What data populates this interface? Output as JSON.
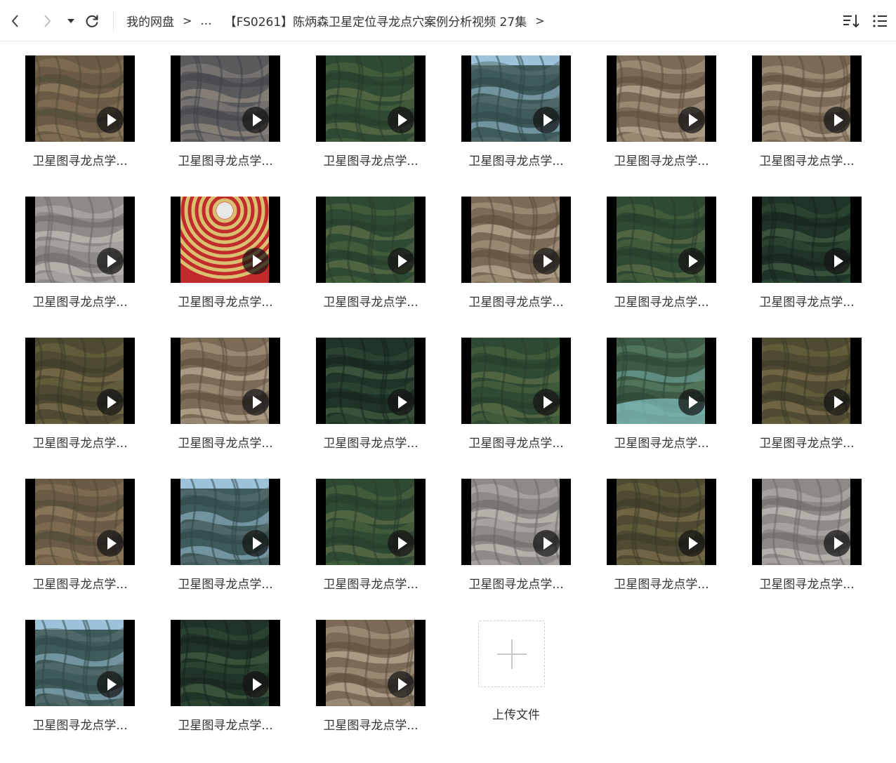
{
  "toolbar": {
    "back_icon": "chevron-left-icon",
    "forward_icon": "chevron-right-icon",
    "dropdown_icon": "caret-down-icon",
    "refresh_icon": "refresh-icon",
    "breadcrumbs": [
      "我的网盘",
      "...",
      "【FS0261】陈炳森卫星定位寻龙点穴案例分析视频 27集"
    ],
    "sort_icon": "sort-icon",
    "list_view_icon": "list-view-icon"
  },
  "files": [
    {
      "name": "卫星图寻龙点学...",
      "palette": "brown"
    },
    {
      "name": "卫星图寻龙点学...",
      "palette": "gray"
    },
    {
      "name": "卫星图寻龙点学...",
      "palette": "green"
    },
    {
      "name": "卫星图寻龙点学...",
      "palette": "sky"
    },
    {
      "name": "卫星图寻龙点学...",
      "palette": "tan"
    },
    {
      "name": "卫星图寻龙点学...",
      "palette": "tan"
    },
    {
      "name": "卫星图寻龙点学...",
      "palette": "lightgray"
    },
    {
      "name": "卫星图寻龙点学...",
      "palette": "compass"
    },
    {
      "name": "卫星图寻龙点学...",
      "palette": "green"
    },
    {
      "name": "卫星图寻龙点学...",
      "palette": "tan"
    },
    {
      "name": "卫星图寻龙点学...",
      "palette": "green"
    },
    {
      "name": "卫星图寻龙点学...",
      "palette": "darkgreen"
    },
    {
      "name": "卫星图寻龙点学...",
      "palette": "olive"
    },
    {
      "name": "卫星图寻龙点学...",
      "palette": "tan"
    },
    {
      "name": "卫星图寻龙点学...",
      "palette": "darkgreen"
    },
    {
      "name": "卫星图寻龙点学...",
      "palette": "green"
    },
    {
      "name": "卫星图寻龙点学...",
      "palette": "water"
    },
    {
      "name": "卫星图寻龙点学...",
      "palette": "olive"
    },
    {
      "name": "卫星图寻龙点学...",
      "palette": "brown"
    },
    {
      "name": "卫星图寻龙点学...",
      "palette": "sky"
    },
    {
      "name": "卫星图寻龙点学...",
      "palette": "green"
    },
    {
      "name": "卫星图寻龙点学...",
      "palette": "lightgray"
    },
    {
      "name": "卫星图寻龙点学...",
      "palette": "olive"
    },
    {
      "name": "卫星图寻龙点学...",
      "palette": "lightgray"
    },
    {
      "name": "卫星图寻龙点学...",
      "palette": "sky"
    },
    {
      "name": "卫星图寻龙点学...",
      "palette": "darkgreen"
    },
    {
      "name": "卫星图寻龙点学...",
      "palette": "tan"
    }
  ],
  "upload": {
    "label": "上传文件",
    "icon": "plus-icon"
  },
  "palettes": {
    "brown": [
      "#6b5a45",
      "#8a7658",
      "#4d4a36",
      "#a08a6a"
    ],
    "gray": [
      "#5a5a5c",
      "#8b8580",
      "#3f4248",
      "#a59a8c"
    ],
    "green": [
      "#2f4a32",
      "#4f6a3f",
      "#253a2a",
      "#6a7a4e"
    ],
    "sky": [
      "#3e5a5a",
      "#5d7572",
      "#2d4646",
      "#9cc3da"
    ],
    "tan": [
      "#7a6a56",
      "#b0a08a",
      "#5a4b3c",
      "#d0c2aa"
    ],
    "lightgray": [
      "#8e8b86",
      "#b9b5ae",
      "#6a6864",
      "#d2cec6"
    ],
    "compass": [
      "#b54a35",
      "#d9c070",
      "#1f2f5a",
      "#c22b2b"
    ],
    "darkgreen": [
      "#1f3326",
      "#33503a",
      "#15231b",
      "#4b6a4a"
    ],
    "olive": [
      "#4f4a32",
      "#6e6b42",
      "#3a3826",
      "#8b7a52"
    ],
    "water": [
      "#3d5a46",
      "#5f8a6a",
      "#2c4436",
      "#7ab6b0"
    ]
  }
}
